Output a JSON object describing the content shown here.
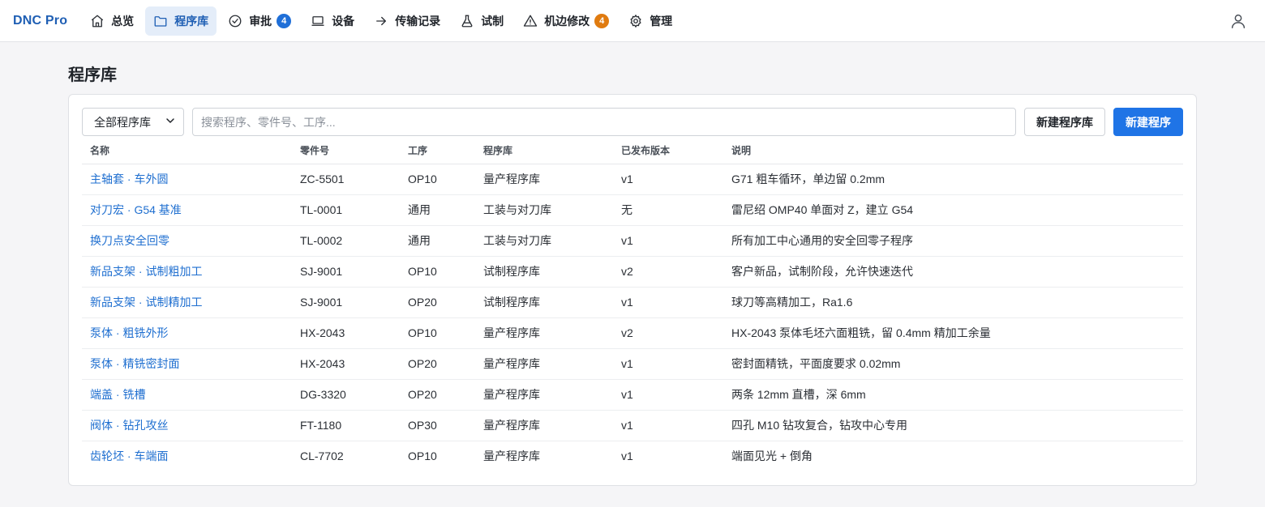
{
  "app": {
    "brand": "DNC Pro"
  },
  "nav": [
    {
      "label": "总览",
      "icon": "home-icon",
      "active": false
    },
    {
      "label": "程序库",
      "icon": "folder-icon",
      "active": true
    },
    {
      "label": "审批",
      "icon": "check-circle-icon",
      "active": false,
      "badge": "4",
      "badge_color": "#1f6fd8"
    },
    {
      "label": "设备",
      "icon": "monitor-icon",
      "active": false
    },
    {
      "label": "传输记录",
      "icon": "arrow-right-icon",
      "active": false
    },
    {
      "label": "试制",
      "icon": "flask-icon",
      "active": false
    },
    {
      "label": "机边修改",
      "icon": "warning-icon",
      "active": false,
      "badge": "4",
      "badge_color": "#e07b10"
    },
    {
      "label": "管理",
      "icon": "gear-icon",
      "active": false
    }
  ],
  "page": {
    "title": "程序库"
  },
  "toolbar": {
    "library_filter": "全部程序库",
    "search_placeholder": "搜索程序、零件号、工序...",
    "new_library_label": "新建程序库",
    "new_program_label": "新建程序"
  },
  "table": {
    "headers": [
      "名称",
      "零件号",
      "工序",
      "程序库",
      "已发布版本",
      "说明"
    ],
    "rows": [
      [
        "主轴套 · 车外圆",
        "ZC-5501",
        "OP10",
        "量产程序库",
        "v1",
        "G71 粗车循环，单边留 0.2mm"
      ],
      [
        "对刀宏 · G54 基准",
        "TL-0001",
        "通用",
        "工装与对刀库",
        "无",
        "雷尼绍 OMP40 单面对 Z，建立 G54"
      ],
      [
        "换刀点安全回零",
        "TL-0002",
        "通用",
        "工装与对刀库",
        "v1",
        "所有加工中心通用的安全回零子程序"
      ],
      [
        "新品支架 · 试制粗加工",
        "SJ-9001",
        "OP10",
        "试制程序库",
        "v2",
        "客户新品，试制阶段，允许快速迭代"
      ],
      [
        "新品支架 · 试制精加工",
        "SJ-9001",
        "OP20",
        "试制程序库",
        "v1",
        "球刀等高精加工，Ra1.6"
      ],
      [
        "泵体 · 粗铣外形",
        "HX-2043",
        "OP10",
        "量产程序库",
        "v2",
        "HX-2043 泵体毛坯六面粗铣，留 0.4mm 精加工余量"
      ],
      [
        "泵体 · 精铣密封面",
        "HX-2043",
        "OP20",
        "量产程序库",
        "v1",
        "密封面精铣，平面度要求 0.02mm"
      ],
      [
        "端盖 · 铣槽",
        "DG-3320",
        "OP20",
        "量产程序库",
        "v1",
        "两条 12mm 直槽，深 6mm"
      ],
      [
        "阀体 · 钻孔攻丝",
        "FT-1180",
        "OP30",
        "量产程序库",
        "v1",
        "四孔 M10 钻攻复合，钻攻中心专用"
      ],
      [
        "齿轮坯 · 车端面",
        "CL-7702",
        "OP10",
        "量产程序库",
        "v1",
        "端面见光 + 倒角"
      ]
    ]
  }
}
